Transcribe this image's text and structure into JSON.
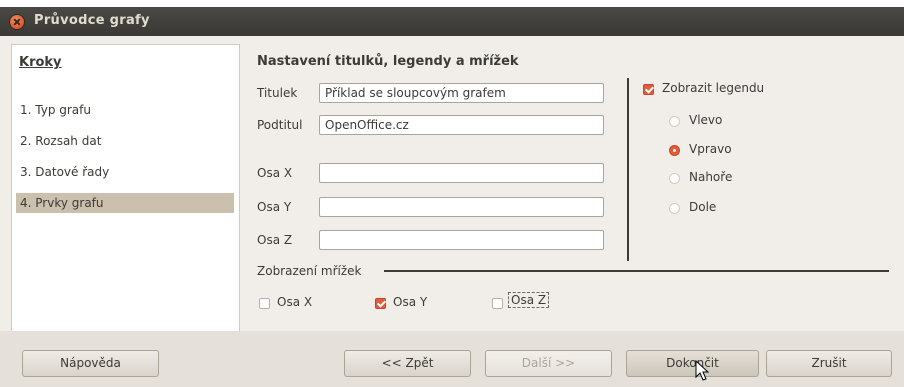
{
  "window": {
    "title": "Průvodce grafy",
    "close_icon": "close-icon"
  },
  "steps": {
    "heading": "Kroky",
    "items": [
      {
        "label": "1. Typ grafu",
        "active": false
      },
      {
        "label": "2. Rozsah dat",
        "active": false
      },
      {
        "label": "3. Datové řady",
        "active": false
      },
      {
        "label": "4. Prvky grafu",
        "active": true
      }
    ]
  },
  "content": {
    "section_title": "Nastavení titulků, legendy a mřížek",
    "fields": {
      "title": {
        "label": "Titulek",
        "value": "Příklad se sloupcovým grafem"
      },
      "subtitle": {
        "label": "Podtitul",
        "value": "OpenOffice.cz"
      },
      "x_axis": {
        "label": "Osa X",
        "value": ""
      },
      "y_axis": {
        "label": "Osa Y",
        "value": ""
      },
      "z_axis": {
        "label": "Osa Z",
        "value": ""
      }
    },
    "legend": {
      "show_label": "Zobrazit legendu",
      "show_checked": true,
      "positions": [
        {
          "label": "Vlevo",
          "selected": false
        },
        {
          "label": "Vpravo",
          "selected": true
        },
        {
          "label": "Nahoře",
          "selected": false
        },
        {
          "label": "Dole",
          "selected": false
        }
      ]
    },
    "grid": {
      "frame_label": "Zobrazení mřížek",
      "x": {
        "label": "Osa X",
        "checked": false
      },
      "y": {
        "label": "Osa Y",
        "checked": true
      },
      "z": {
        "label": "Osa Z",
        "checked": false
      }
    }
  },
  "buttons": {
    "help": "Nápověda",
    "back": "<< Zpět",
    "next": "Další >>",
    "finish": "Dokončit",
    "cancel": "Zrušit"
  },
  "colors": {
    "accent": "#e25b3a",
    "titlebar": "#3f3e3a",
    "dialog_bg": "#f1eeea"
  }
}
